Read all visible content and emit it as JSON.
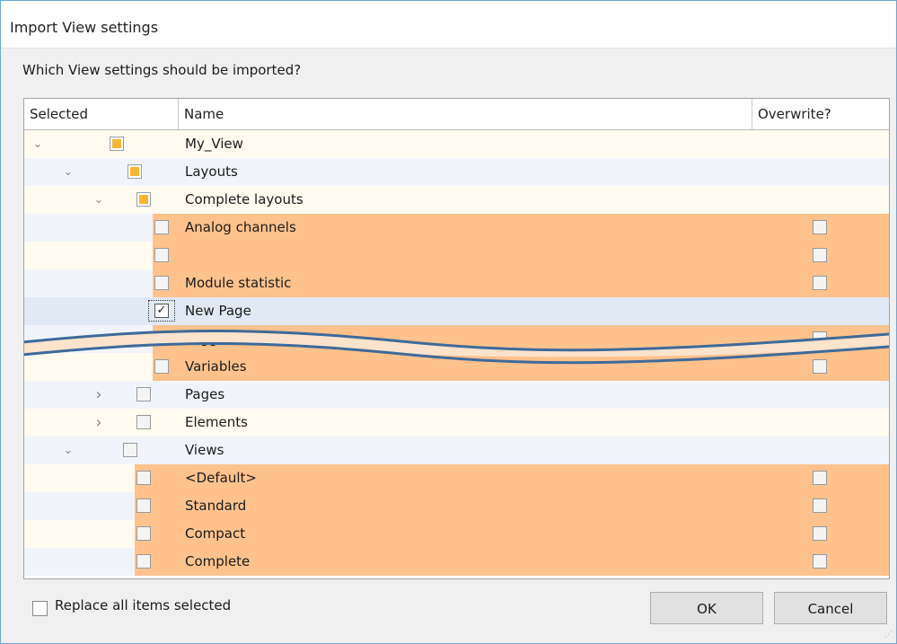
{
  "dialog": {
    "title": "Import View settings",
    "question": "Which View settings should be imported?"
  },
  "grid": {
    "columns": [
      "Selected",
      "Name",
      "Overwrite?"
    ],
    "rows": [
      {
        "name": "My_View",
        "expander": "expanded",
        "state": "indeterminate",
        "overwrite_visible": false,
        "highlighted": false
      },
      {
        "name": "Layouts",
        "expander": "expanded",
        "state": "indeterminate",
        "overwrite_visible": false,
        "highlighted": false
      },
      {
        "name": "Complete layouts",
        "expander": "expanded",
        "state": "indeterminate",
        "overwrite_visible": false,
        "highlighted": false
      },
      {
        "name": "Analog channels",
        "expander": "none",
        "state": "unchecked",
        "overwrite_visible": true,
        "highlighted": true
      },
      {
        "name": "",
        "expander": "none",
        "state": "unchecked",
        "overwrite_visible": true,
        "highlighted": true
      },
      {
        "name": "Module statistic",
        "expander": "none",
        "state": "unchecked",
        "overwrite_visible": true,
        "highlighted": true
      },
      {
        "name": "New Page",
        "expander": "none",
        "state": "checked",
        "overwrite_visible": false,
        "highlighted": false,
        "selected": true
      },
      {
        "name": "Triggers",
        "expander": "none",
        "state": "unchecked",
        "overwrite_visible": true,
        "highlighted": true
      },
      {
        "name": "Variables",
        "expander": "none",
        "state": "unchecked",
        "overwrite_visible": true,
        "highlighted": true
      },
      {
        "name": "Pages",
        "expander": "collapsed",
        "state": "unchecked",
        "overwrite_visible": false,
        "highlighted": false
      },
      {
        "name": "Elements",
        "expander": "collapsed",
        "state": "unchecked",
        "overwrite_visible": false,
        "highlighted": false
      },
      {
        "name": "Views",
        "expander": "expanded",
        "state": "unchecked",
        "overwrite_visible": false,
        "highlighted": false
      },
      {
        "name": "<Default>",
        "expander": "none",
        "state": "unchecked",
        "overwrite_visible": true,
        "highlighted": true
      },
      {
        "name": "Standard",
        "expander": "none",
        "state": "unchecked",
        "overwrite_visible": true,
        "highlighted": true
      },
      {
        "name": "Compact",
        "expander": "none",
        "state": "unchecked",
        "overwrite_visible": true,
        "highlighted": true
      },
      {
        "name": "Complete",
        "expander": "none",
        "state": "unchecked",
        "overwrite_visible": true,
        "highlighted": true
      }
    ]
  },
  "footer": {
    "replace_label": "Replace all items selected",
    "replace_checked": false,
    "ok_label": "OK",
    "cancel_label": "Cancel"
  },
  "colors": {
    "highlight": "#ffc28d",
    "indeterminate": "#f7b733",
    "row_alt_light": "#fffbf0",
    "row_alt_blue": "#f1f5fb",
    "selected_row": "#e1e9f5",
    "wave_stroke": "#3f6a9a"
  }
}
